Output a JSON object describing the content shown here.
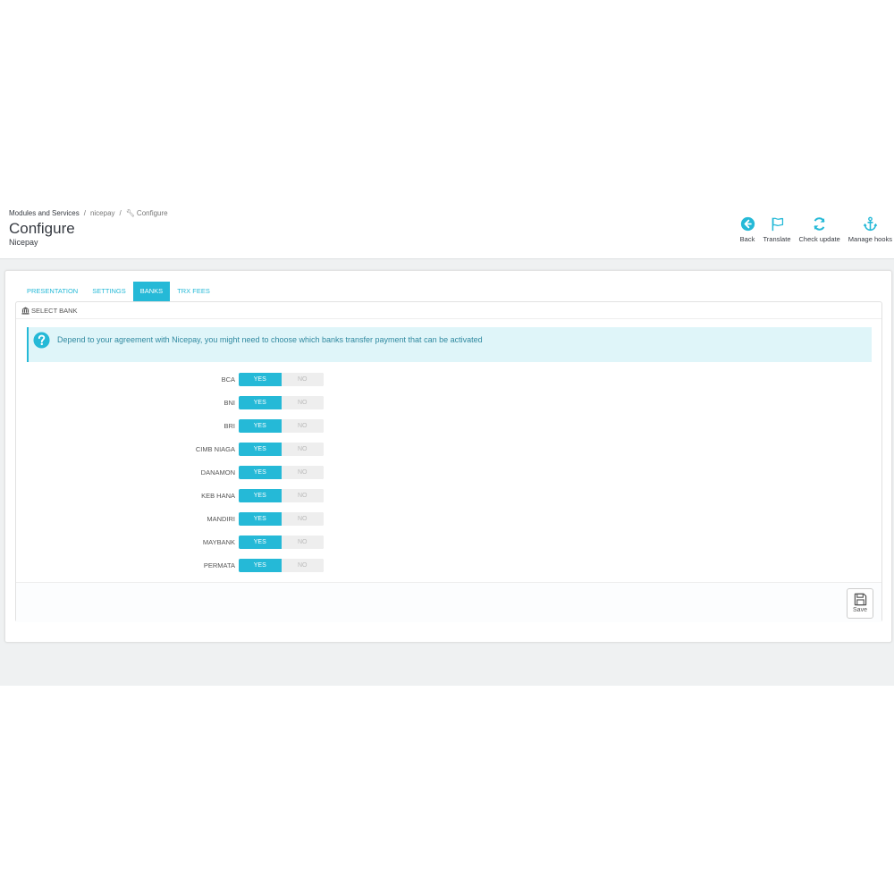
{
  "breadcrumb": {
    "item1": "Modules and Services",
    "item2": "nicepay",
    "item3": "Configure"
  },
  "header": {
    "title": "Configure",
    "subtitle": "Nicepay"
  },
  "toolbar": [
    {
      "label": "Back",
      "icon": "back-circle-arrow-icon"
    },
    {
      "label": "Translate",
      "icon": "flag-icon"
    },
    {
      "label": "Check update",
      "icon": "refresh-icon"
    },
    {
      "label": "Manage hooks",
      "icon": "anchor-icon"
    }
  ],
  "tabs": [
    {
      "label": "PRESENTATION",
      "active": false
    },
    {
      "label": "SETTINGS",
      "active": false
    },
    {
      "label": "BANKS",
      "active": true
    },
    {
      "label": "TRX FEES",
      "active": false
    }
  ],
  "section": {
    "title": "SELECT BANK",
    "icon": "bank-icon"
  },
  "alert": {
    "text": "Depend to your agreement with Nicepay, you might need to choose which banks transfer payment that can be activated",
    "icon": "question-circle-icon"
  },
  "switch_labels": {
    "yes": "YES",
    "no": "NO"
  },
  "banks": [
    {
      "label": "BCA",
      "value": "yes"
    },
    {
      "label": "BNI",
      "value": "yes"
    },
    {
      "label": "BRI",
      "value": "yes"
    },
    {
      "label": "CIMB NIAGA",
      "value": "yes"
    },
    {
      "label": "DANAMON",
      "value": "yes"
    },
    {
      "label": "KEB HANA",
      "value": "yes"
    },
    {
      "label": "MANDIRI",
      "value": "yes"
    },
    {
      "label": "MAYBANK",
      "value": "yes"
    },
    {
      "label": "PERMATA",
      "value": "yes"
    }
  ],
  "footer": {
    "save_label": "Save"
  },
  "colors": {
    "accent": "#25b9d7",
    "alert_bg": "#dff5f9",
    "alert_text": "#3089a0",
    "page_bg": "#eff1f2"
  }
}
